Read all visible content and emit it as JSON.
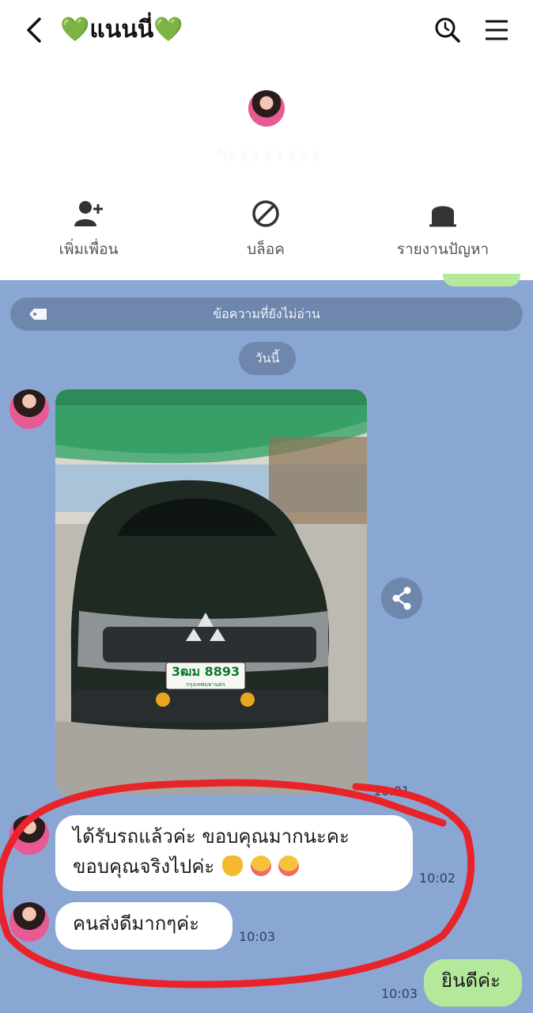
{
  "header": {
    "title": "💚แนนนี่💚",
    "profile_id": "ꞌ꞉꞉ ꞉ ꞉ ꞉ ꞉ ꞉ ꞉ ꞉",
    "actions": [
      {
        "label": "เพิ่มเพื่อน",
        "icon": "add-friend-icon"
      },
      {
        "label": "บล็อค",
        "icon": "block-icon"
      },
      {
        "label": "รายงานปัญหา",
        "icon": "report-icon"
      }
    ]
  },
  "chat": {
    "unread_label": "ข้อความที่ยังไม่อ่าน",
    "date_label": "วันนี้",
    "messages": [
      {
        "type": "image",
        "time": "10:01",
        "plate": "3ฒม 8893",
        "plate_province": "กรุงเทพมหานคร"
      },
      {
        "type": "text",
        "time": "10:02",
        "lines": [
          "ได้รับรถแล้วค่ะ ขอบคุณมากนะคะ",
          "ขอบคุณจริงไปค่ะ"
        ],
        "emoji": [
          "crossed-fingers",
          "smiling-face-with-hearts",
          "smiling-face-with-hearts"
        ]
      },
      {
        "type": "text",
        "time": "10:03",
        "lines": [
          "คนส่งดีมากๆค่ะ"
        ]
      },
      {
        "type": "text",
        "from": "me",
        "time": "10:03",
        "lines": [
          "ยินดีค่ะ"
        ]
      }
    ]
  },
  "colors": {
    "chat_bg": "#8aa7d4",
    "pill_bg": "#6f86ad",
    "my_bubble": "#b4e89a",
    "highlight_circle": "#e8232a"
  }
}
